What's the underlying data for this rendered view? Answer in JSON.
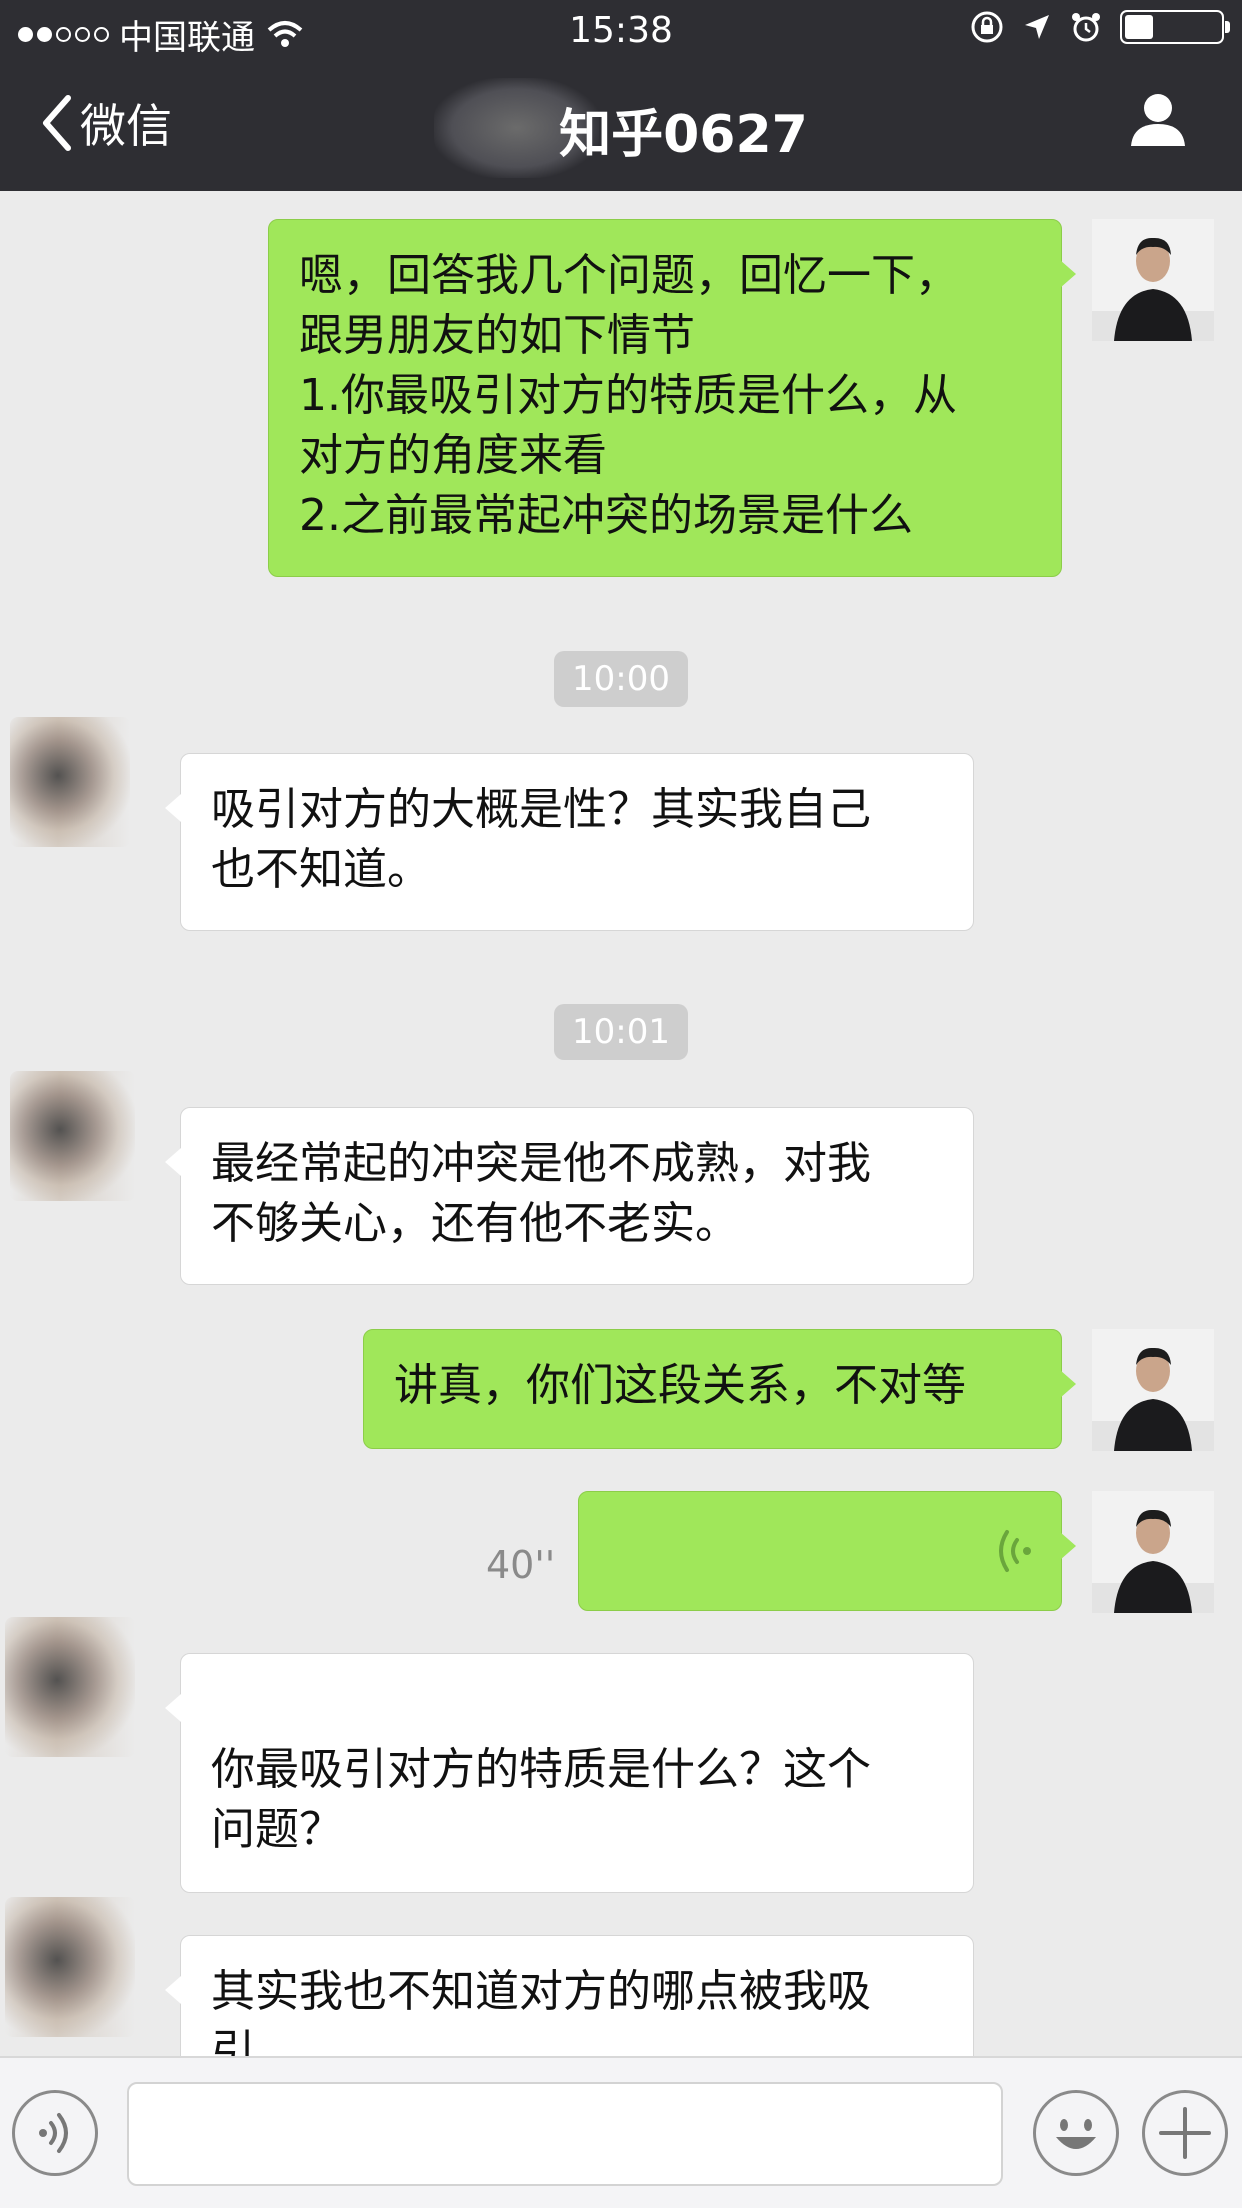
{
  "status": {
    "carrier": "中国联通",
    "time": "15:38",
    "battery_level": 0.3
  },
  "nav": {
    "back_label": "微信",
    "title": "知乎0627"
  },
  "chat": {
    "msg1": "嗯，回答我几个问题，回忆一下，\n跟男朋友的如下情节\n1.你最吸引对方的特质是什么，从\n对方的角度来看\n2.之前最常起冲突的场景是什么",
    "ts1": "10:00",
    "msg2": "吸引对方的大概是性？其实我自己\n也不知道。",
    "ts2": "10:01",
    "msg3": "最经常起的冲突是他不成熟，对我\n不够关心，还有他不老实。",
    "msg4": "讲真，你们这段关系，不对等",
    "voice_duration": "40''",
    "msg6": "你最吸引对方的特质是什么？这个\n问题？",
    "msg7": "其实我也不知道对方的哪点被我吸\n引"
  },
  "input": {
    "placeholder": ""
  },
  "icons": {
    "back": "chevron-left-icon",
    "profile": "person-icon",
    "voice": "voice-icon",
    "emoji": "emoji-icon",
    "more": "plus-icon"
  }
}
